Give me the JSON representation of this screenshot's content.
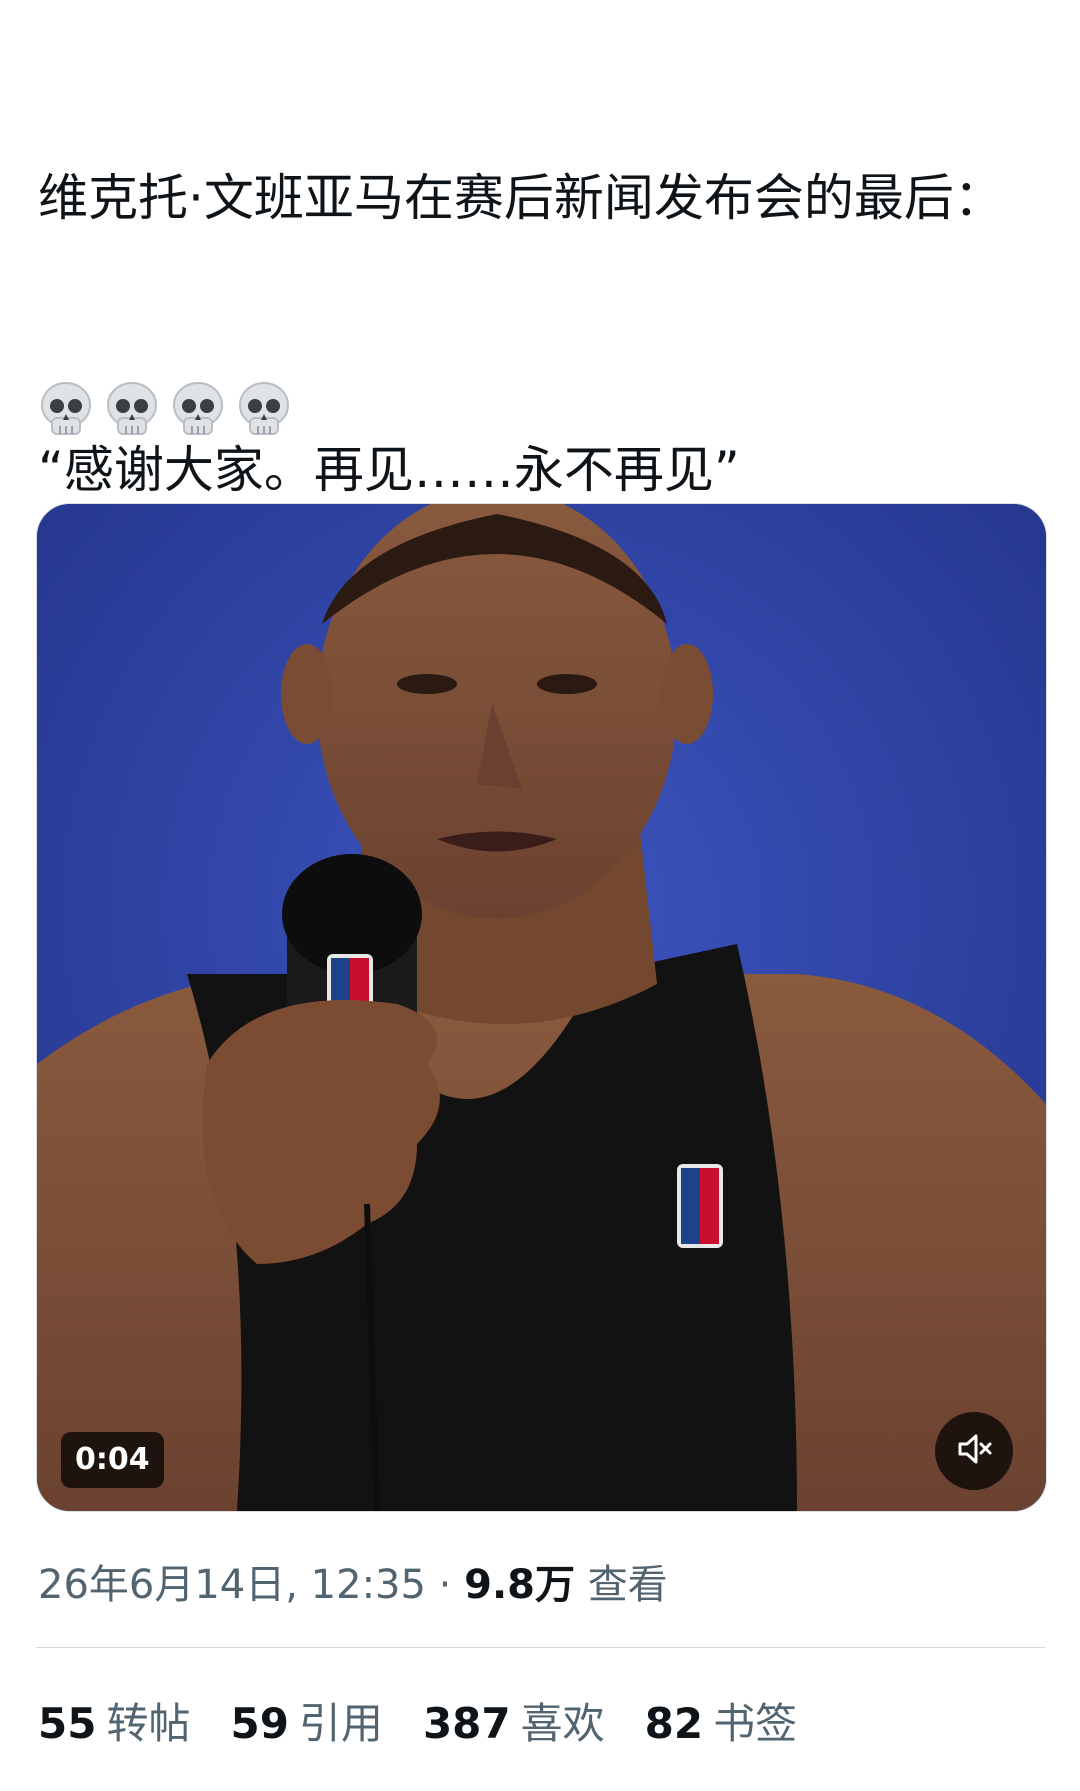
{
  "post": {
    "text_line1": "维克托·文班亚马在赛后新闻发布会的最后：",
    "quote": "“感谢大家。再见……永不再见”",
    "emojis": [
      "skull-emoji",
      "skull-emoji",
      "skull-emoji",
      "skull-emoji"
    ]
  },
  "media": {
    "duration": "0:04",
    "mute_icon": "volume-muted-icon",
    "background_color": "#2f45a8"
  },
  "meta": {
    "timestamp": "26年6月14日, 12:35",
    "separator": "·",
    "views_count": "9.8万",
    "views_label": "查看"
  },
  "stats": [
    {
      "count": "55",
      "label": "转帖"
    },
    {
      "count": "59",
      "label": "引用"
    },
    {
      "count": "387",
      "label": "喜欢"
    },
    {
      "count": "82",
      "label": "书签"
    }
  ]
}
